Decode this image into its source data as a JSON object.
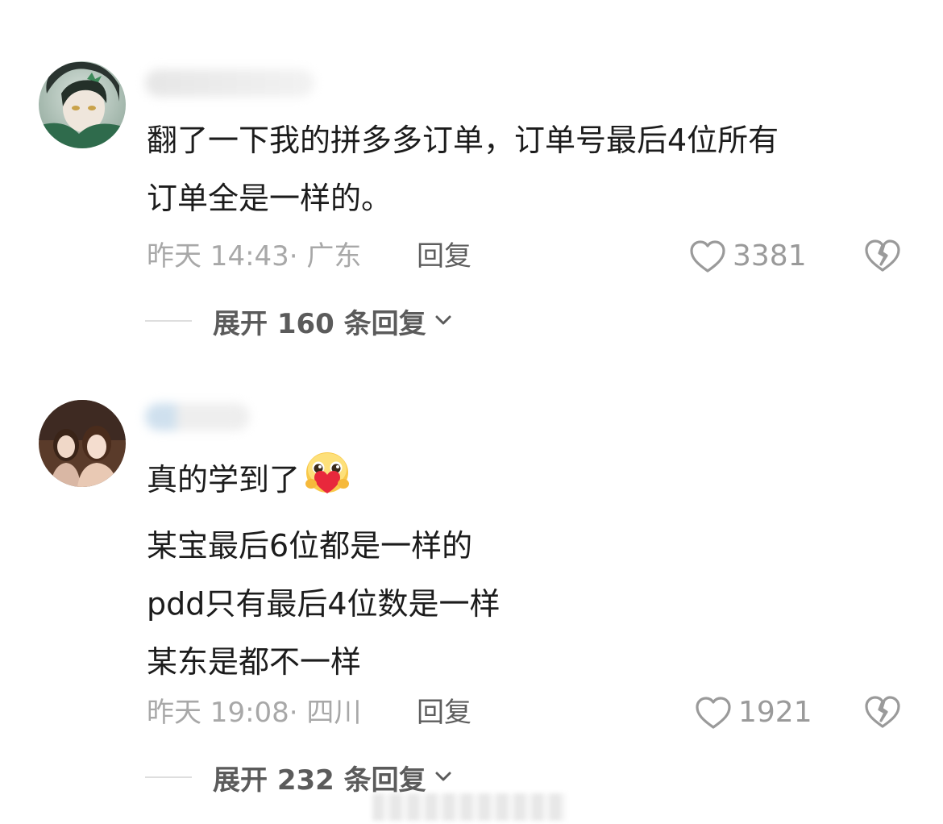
{
  "comments": [
    {
      "content_lines": [
        "翻了一下我的拼多多订单，订单号最后4位所有",
        "订单全是一样的。"
      ],
      "meta": "昨天 14:43· 广东",
      "reply_label": "回复",
      "like_count": "3381",
      "expand_label": "展开 160 条回复"
    },
    {
      "content_lines": [
        "真的学到了",
        "某宝最后6位都是一样的",
        "pdd只有最后4位数是一样",
        "某东是都不一样"
      ],
      "emoji": "heart-hug-emoji",
      "meta": "昨天 19:08· 四川",
      "reply_label": "回复",
      "like_count": "1921",
      "expand_label": "展开 232 条回复"
    }
  ],
  "icons": {
    "like": "heart-outline-icon",
    "dislike": "broken-heart-icon",
    "expand": "chevron-down-icon"
  },
  "colors": {
    "text_primary": "#1c1c1c",
    "text_meta": "#a8a8a8",
    "text_reply": "#5e5e5e",
    "icon_gray": "#9a9a9a"
  }
}
